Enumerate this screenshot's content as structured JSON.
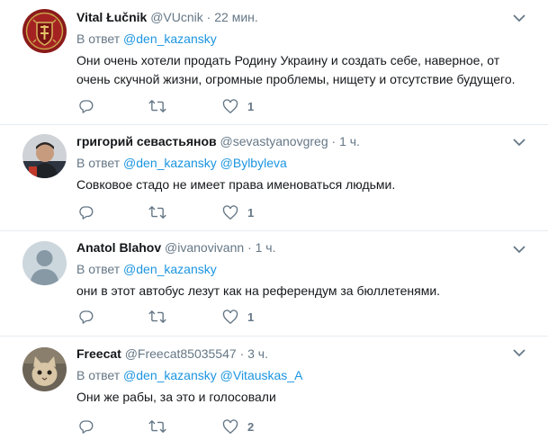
{
  "colors": {
    "link": "#1b95e0",
    "secondary": "#657786",
    "text": "#14171a",
    "divider": "#e6ecf0"
  },
  "tweets": [
    {
      "name": "Vital Łučnik",
      "handle": "@VUcnik",
      "dot": "·",
      "time": "22 мин.",
      "reply_prefix": "В ответ",
      "mentions": [
        "@den_kazansky"
      ],
      "text": "Они очень хотели продать Родину Украину и создать себе, наверное, от очень скучной жизни, огромные проблемы, нищету и отсутствие будущего.",
      "likes": "1",
      "avatar_icon": "coat-of-arms-avatar"
    },
    {
      "name": "григорий севастьянов",
      "handle": "@sevastyanovgreg",
      "dot": "·",
      "time": "1 ч.",
      "reply_prefix": "В ответ",
      "mentions": [
        "@den_kazansky",
        "@Bylbyleva"
      ],
      "text": "Совковое стадо не имеет права именоваться людьми.",
      "likes": "1",
      "avatar_icon": "photo-avatar"
    },
    {
      "name": "Anatol Blahov",
      "handle": "@ivanovivann",
      "dot": "·",
      "time": "1 ч.",
      "reply_prefix": "В ответ",
      "mentions": [
        "@den_kazansky"
      ],
      "text": "они в этот автобус лезут как на референдум за бюллетенями.",
      "likes": "1",
      "avatar_icon": "default-avatar"
    },
    {
      "name": "Freecat",
      "handle": "@Freecat85035547",
      "dot": "·",
      "time": "3 ч.",
      "reply_prefix": "В ответ",
      "mentions": [
        "@den_kazansky",
        "@Vitauskas_A"
      ],
      "text": "Они же рабы, за это и голосовали",
      "likes": "2",
      "avatar_icon": "cat-avatar"
    }
  ]
}
